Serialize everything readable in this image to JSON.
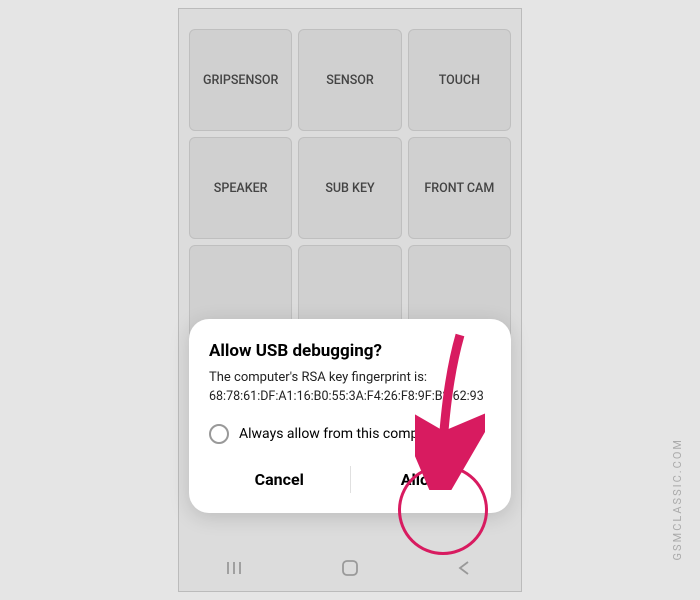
{
  "grid": {
    "items": [
      "GRIPSENSOR",
      "SENSOR",
      "TOUCH",
      "SPEAKER",
      "SUB KEY",
      "FRONT CAM",
      "",
      "",
      ""
    ]
  },
  "dialog": {
    "title": "Allow USB debugging?",
    "body": "The computer's RSA key fingerprint is:",
    "fingerprint": "68:78:61:DF:A1:16:B0:55:3A:F4:26:F8:9F:B2:62:93",
    "checkbox_label": "Always allow from this computer",
    "cancel": "Cancel",
    "allow": "Allow"
  },
  "watermark": "GSMCLASSIC.COM"
}
